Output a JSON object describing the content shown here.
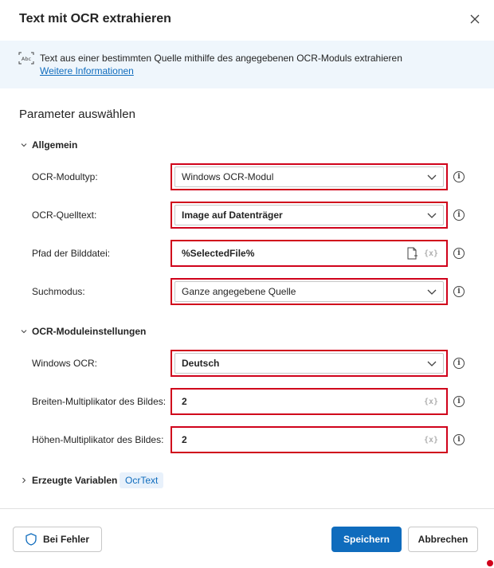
{
  "dialog": {
    "title": "Text mit OCR extrahieren",
    "description": "Text aus einer bestimmten Quelle mithilfe des angegebenen OCR-Moduls extrahieren",
    "more_info_link": "Weitere Informationen",
    "section_title": "Parameter auswählen"
  },
  "groups": {
    "general": {
      "label": "Allgemein",
      "fields": {
        "ocr_module_type": {
          "label": "OCR-Modultyp:",
          "value": "Windows OCR-Modul"
        },
        "ocr_source_text": {
          "label": "OCR-Quelltext:",
          "value": "Image auf Datenträger"
        },
        "image_path": {
          "label": "Pfad der Bilddatei:",
          "value": "%SelectedFile%",
          "var_indicator": "{x}"
        },
        "search_mode": {
          "label": "Suchmodus:",
          "value": "Ganze angegebene Quelle"
        }
      }
    },
    "ocr_settings": {
      "label": "OCR-Moduleinstellungen",
      "fields": {
        "windows_ocr": {
          "label": "Windows OCR:",
          "value": "Deutsch"
        },
        "width_multiplier": {
          "label": "Breiten-Multiplikator des Bildes:",
          "value": "2",
          "var_indicator": "{x}"
        },
        "height_multiplier": {
          "label": "Höhen-Multiplikator des Bildes:",
          "value": "2",
          "var_indicator": "{x}"
        }
      }
    },
    "produced_variables": {
      "label": "Erzeugte Variablen",
      "chip": "OcrText"
    }
  },
  "footer": {
    "on_error_label": "Bei Fehler",
    "save_label": "Speichern",
    "cancel_label": "Abbrechen"
  },
  "help_glyph": "i",
  "icons": [
    "close-icon",
    "ocr-icon",
    "chevron-down-icon",
    "chevron-right-icon",
    "file-icon",
    "info-icon",
    "shield-icon"
  ],
  "colors": {
    "accent": "#0f6cbd",
    "highlight_border": "#d0021b",
    "banner_bg": "#eff6fc",
    "chip_bg": "#e8f1fb"
  }
}
